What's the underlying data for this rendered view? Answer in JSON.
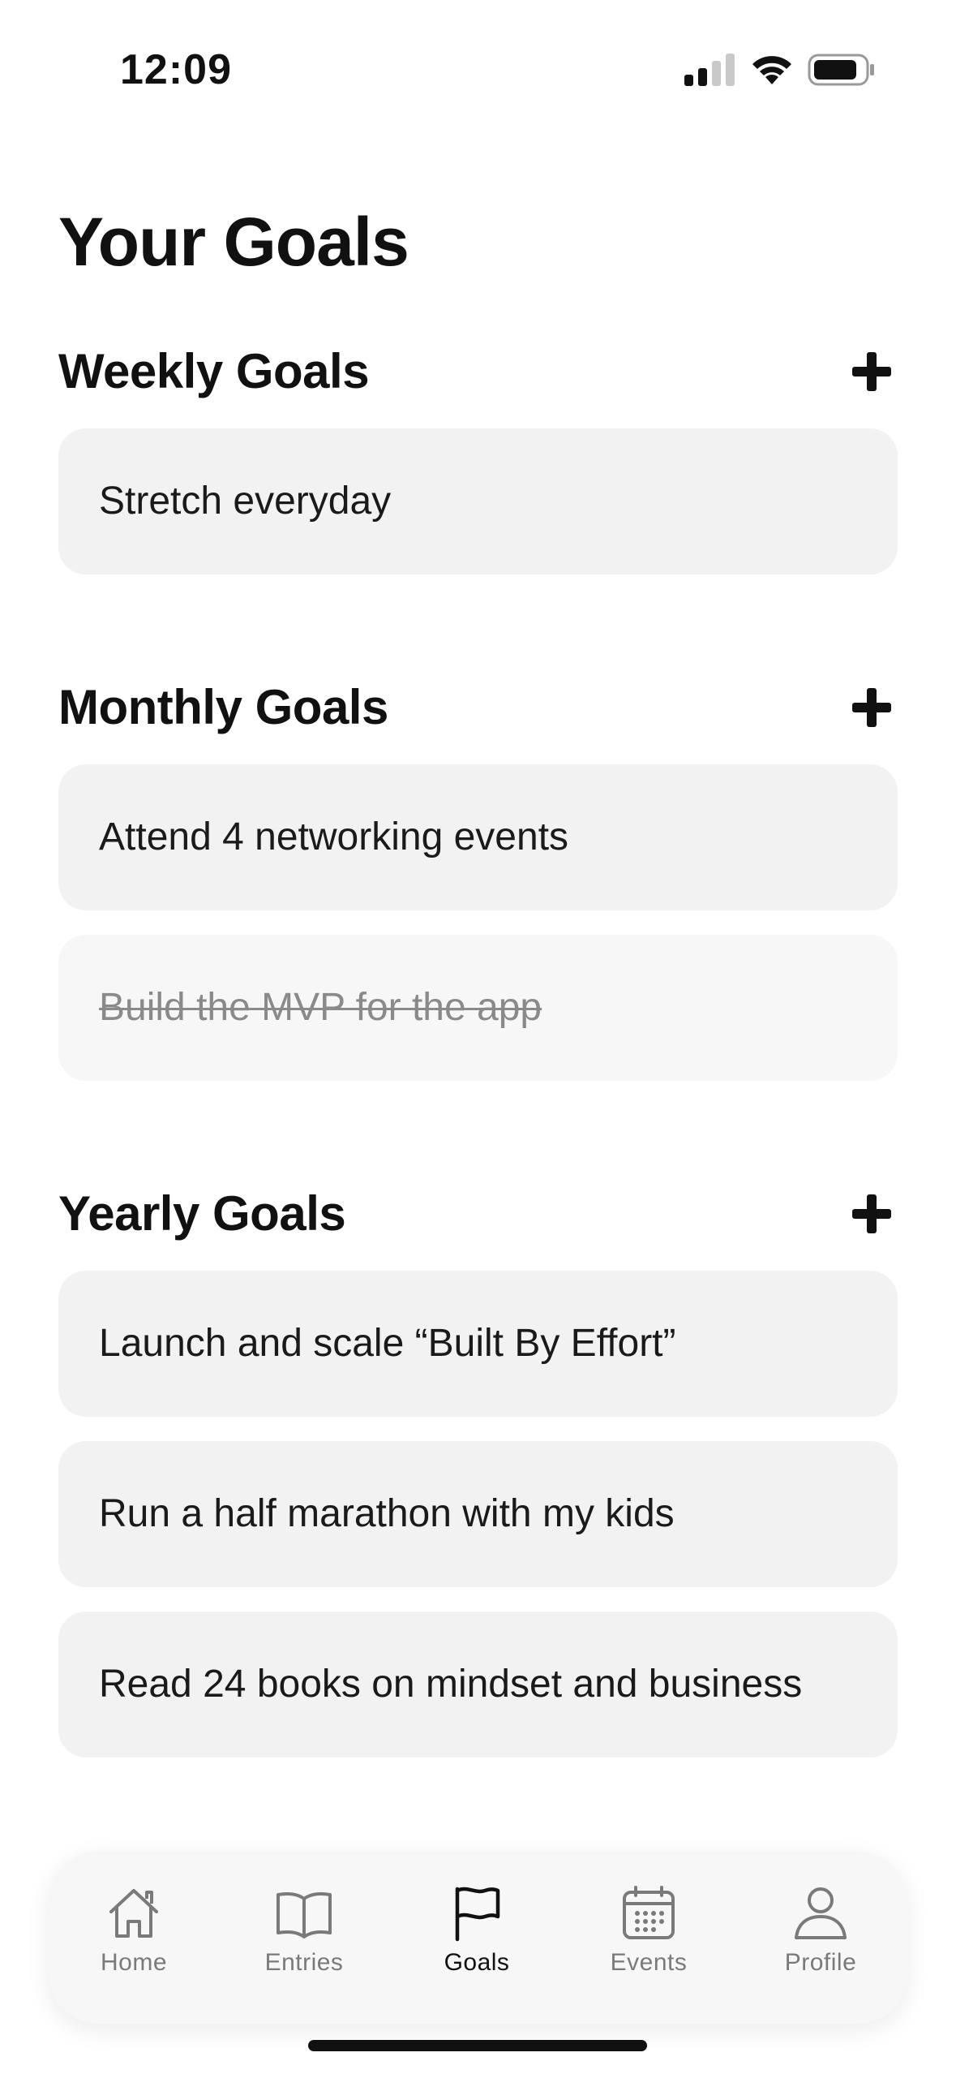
{
  "status_bar": {
    "time": "12:09"
  },
  "page": {
    "title": "Your Goals"
  },
  "sections": [
    {
      "title": "Weekly Goals",
      "goals": [
        {
          "text": "Stretch everyday",
          "completed": false
        }
      ]
    },
    {
      "title": "Monthly Goals",
      "goals": [
        {
          "text": "Attend 4 networking events",
          "completed": false
        },
        {
          "text": "Build the MVP for the app",
          "completed": true
        }
      ]
    },
    {
      "title": "Yearly Goals",
      "goals": [
        {
          "text": "Launch and scale “Built By Effort”",
          "completed": false
        },
        {
          "text": "Run a half marathon with my kids",
          "completed": false
        },
        {
          "text": "Read 24 books on mindset and business",
          "completed": false
        }
      ]
    }
  ],
  "tab_bar": {
    "tabs": [
      {
        "label": "Home",
        "icon": "home-icon",
        "active": false
      },
      {
        "label": "Entries",
        "icon": "book-icon",
        "active": false
      },
      {
        "label": "Goals",
        "icon": "flag-icon",
        "active": true
      },
      {
        "label": "Events",
        "icon": "calendar-icon",
        "active": false
      },
      {
        "label": "Profile",
        "icon": "person-icon",
        "active": false
      }
    ]
  },
  "colors": {
    "card_background": "#f2f2f2",
    "completed_card_background": "#f7f7f7",
    "completed_text": "#8a8a8a",
    "active_tab": "#111111",
    "inactive_tab": "#7a7a7a"
  }
}
